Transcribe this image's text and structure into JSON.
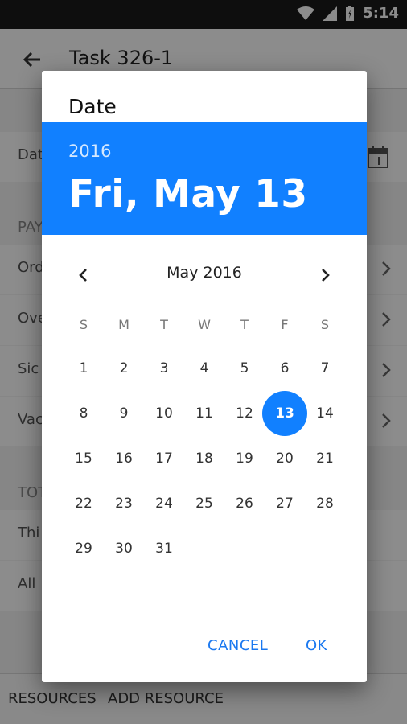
{
  "status_bar": {
    "time": "5:14"
  },
  "app_bar": {
    "title": "Task 326-1"
  },
  "background": {
    "date_row_label": "Dat",
    "pay_section": "PAY",
    "rows": [
      "Ord",
      "Ove",
      "Sic",
      "Vac"
    ],
    "total_section": "TOT",
    "this_label": "Thi",
    "all_label": "All"
  },
  "footer": {
    "resources": "RESOURCES",
    "add_resource": "ADD RESOURCE"
  },
  "dialog": {
    "title": "Date",
    "selected_year": "2016",
    "selected_date": "Fri, May 13",
    "month_label": "May 2016",
    "weekdays": [
      "S",
      "M",
      "T",
      "W",
      "T",
      "F",
      "S"
    ],
    "weeks": [
      [
        "1",
        "2",
        "3",
        "4",
        "5",
        "6",
        "7"
      ],
      [
        "8",
        "9",
        "10",
        "11",
        "12",
        "13",
        "14"
      ],
      [
        "15",
        "16",
        "17",
        "18",
        "19",
        "20",
        "21"
      ],
      [
        "22",
        "23",
        "24",
        "25",
        "26",
        "27",
        "28"
      ],
      [
        "29",
        "30",
        "31",
        "",
        "",
        "",
        ""
      ]
    ],
    "selected_day": "13",
    "cancel_label": "CANCEL",
    "ok_label": "OK"
  },
  "colors": {
    "accent": "#1180ff",
    "button_text": "#1a78f0"
  }
}
